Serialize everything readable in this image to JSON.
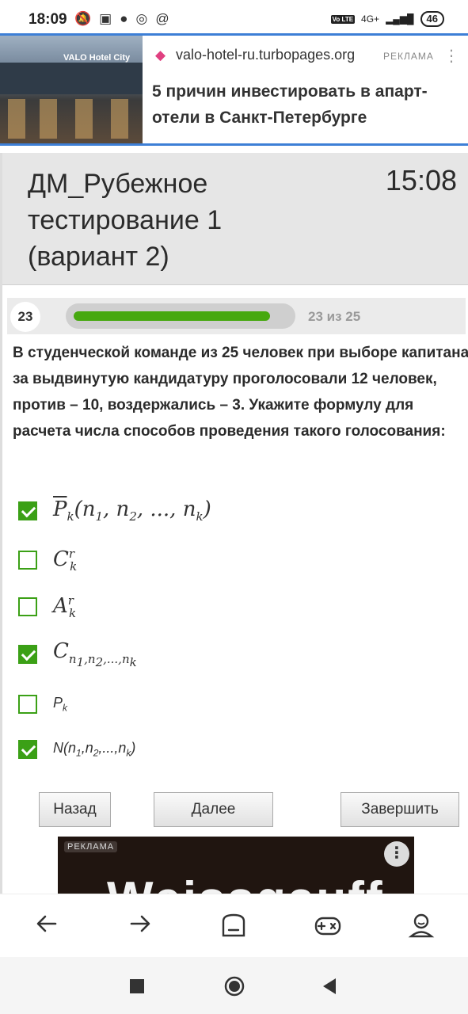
{
  "status_bar": {
    "time": "18:09",
    "battery": "46",
    "network": "4G+",
    "lte_badge": "Vo LTE"
  },
  "ad_banner": {
    "image_text": "VALO Hotel City",
    "domain": "valo-hotel-ru.turbopages.org",
    "label": "РЕКЛАМА",
    "title": "5 причин инвестировать в апарт-отели в Санкт-Петербурге"
  },
  "test": {
    "title": "ДМ_Рубежное тестирование 1 (вариант 2)",
    "timer": "15:08",
    "question_number": "23",
    "progress_text": "23 из 25",
    "progress_fraction": 0.92,
    "question": "В студенческой команде из 25 человек при выборе капитана за выдвинутую кандидатуру проголосовали 12 человек, против – 10, воздержались – 3. Укажите формулу для расчета числа способов проведения такого голосования:",
    "options": [
      {
        "checked": true
      },
      {
        "checked": false
      },
      {
        "checked": false
      },
      {
        "checked": true
      },
      {
        "checked": false
      },
      {
        "checked": true
      }
    ],
    "buttons": {
      "back": "Назад",
      "next": "Далее",
      "finish": "Завершить"
    }
  },
  "ad_block": {
    "label": "РЕКЛАМА",
    "brand": "Weissgauff"
  },
  "colors": {
    "accent_green": "#3ba016",
    "progress_green": "#46a80f",
    "ad_border_blue": "#3d7fd6"
  }
}
